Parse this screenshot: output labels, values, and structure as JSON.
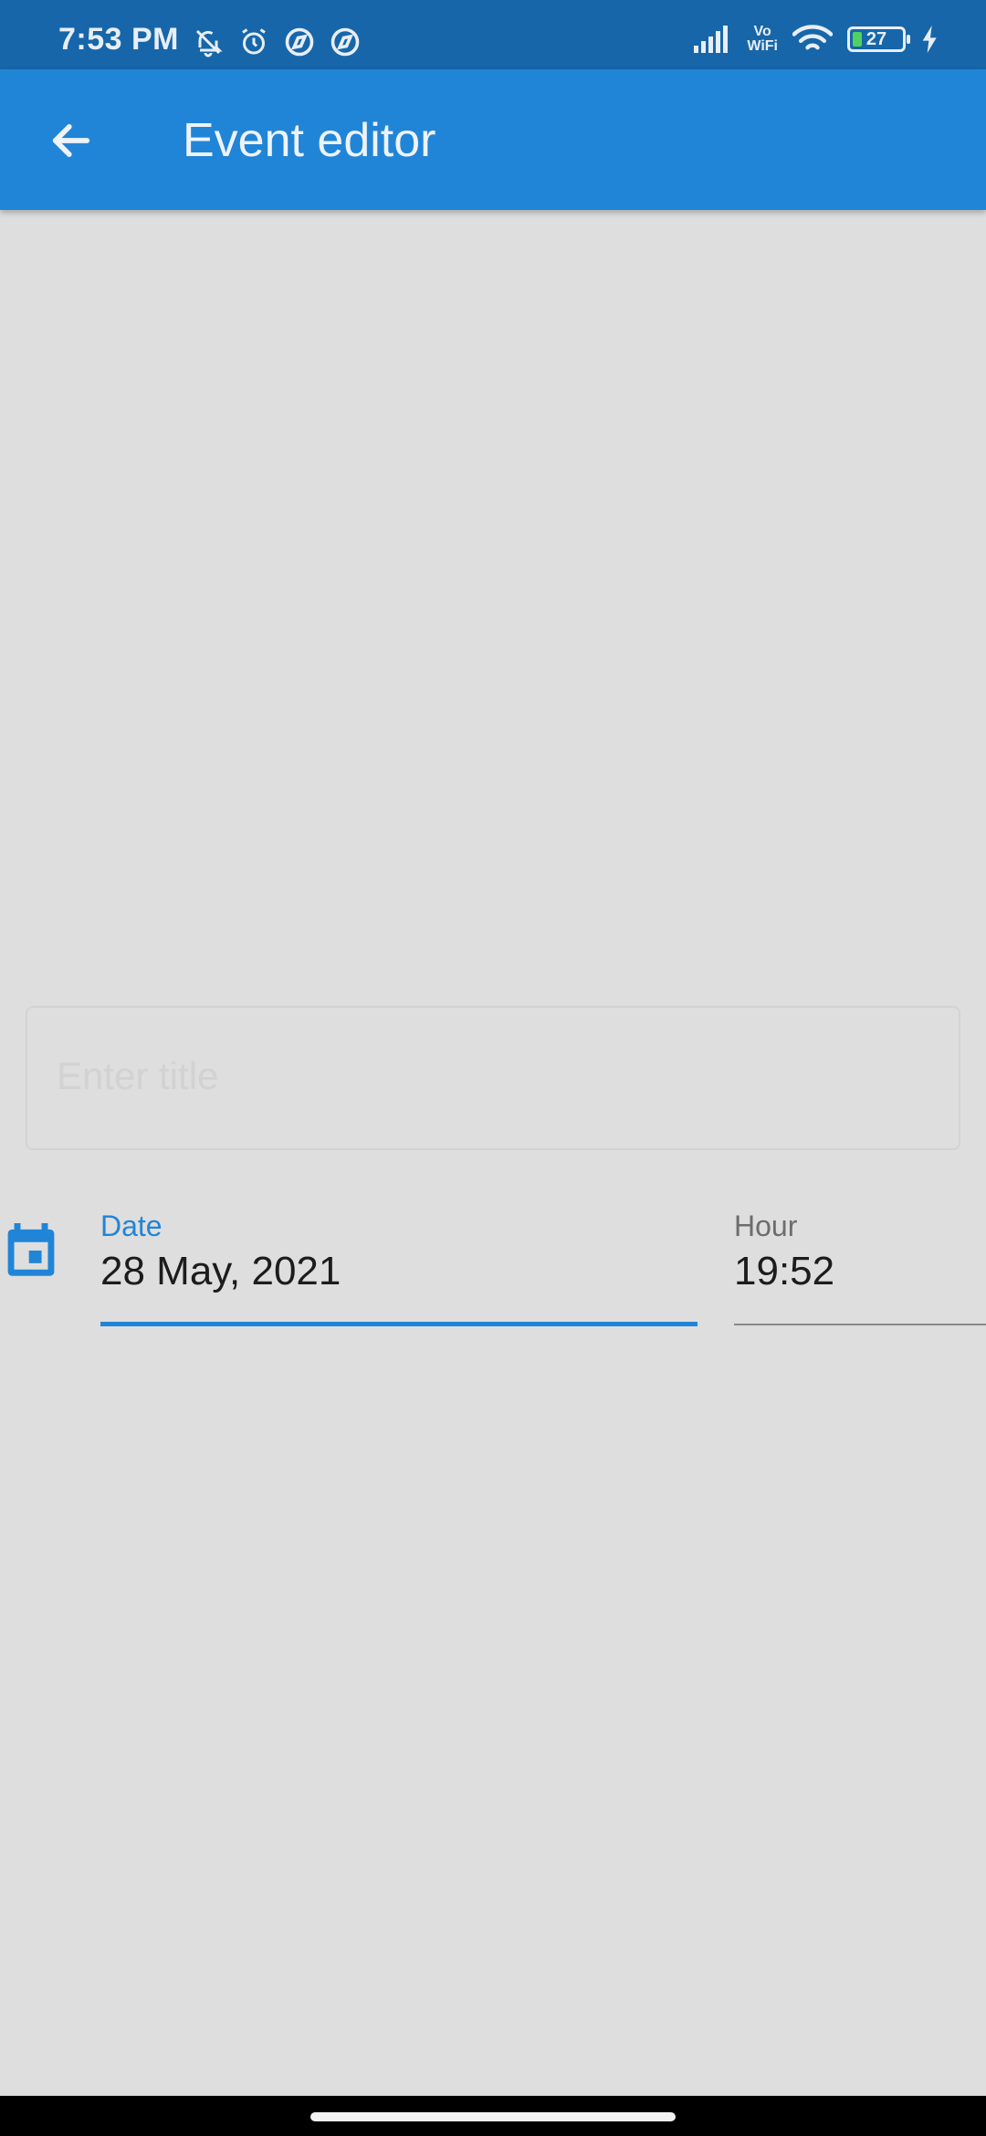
{
  "status_bar": {
    "time": "7:53 PM",
    "left_icons": [
      "bell-off-icon",
      "alarm-icon",
      "compass-icon",
      "compass-icon"
    ],
    "vo_label": "Vo",
    "wifi_label": "WiFi",
    "battery_level": "27",
    "right_icons": [
      "signal-icon",
      "wifi-icon",
      "battery-icon",
      "charging-icon"
    ]
  },
  "app_bar": {
    "title": "Event editor",
    "back_icon": "arrow-left-icon"
  },
  "form": {
    "title_placeholder": "Enter title",
    "title_value": "",
    "date_label": "Date",
    "date_value": "28 May, 2021",
    "hour_label": "Hour",
    "hour_value": "19:52",
    "calendar_icon": "calendar-icon"
  },
  "colors": {
    "status_bar_bg": "#1766a9",
    "app_bar_bg": "#2185d7",
    "accent": "#2185d7",
    "page_bg": "#dedede"
  }
}
